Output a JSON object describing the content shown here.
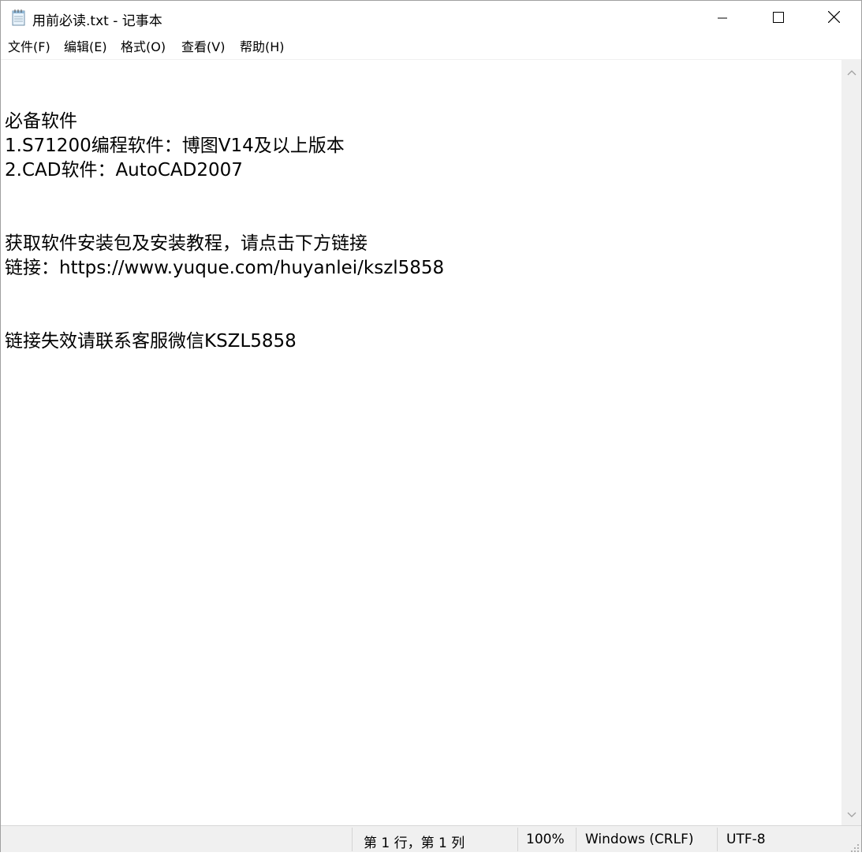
{
  "window": {
    "title": "用前必读.txt - 记事本",
    "icon": "notepad-icon",
    "controls": {
      "minimize_icon": "minimize-icon",
      "maximize_icon": "maximize-icon",
      "close_icon": "close-icon"
    }
  },
  "menu": {
    "items": [
      {
        "label": "文件(F)"
      },
      {
        "label": "编辑(E)"
      },
      {
        "label": "格式(O)"
      },
      {
        "label": "查看(V)"
      },
      {
        "label": "帮助(H)"
      }
    ]
  },
  "document": {
    "lines": [
      "",
      "",
      "必备软件",
      "1.S71200编程软件：博图V14及以上版本",
      "2.CAD软件：AutoCAD2007",
      "",
      "",
      "获取软件安装包及安装教程，请点击下方链接",
      "链接：https://www.yuque.com/huyanlei/kszl5858",
      "",
      "",
      "链接失效请联系客服微信KSZL5858"
    ]
  },
  "status": {
    "position": "第 1 行，第 1 列",
    "zoom": "100%",
    "line_ending": "Windows (CRLF)",
    "encoding": "UTF-8"
  },
  "colors": {
    "chrome": "#f0f0f0",
    "text": "#000000",
    "background": "#ffffff"
  }
}
